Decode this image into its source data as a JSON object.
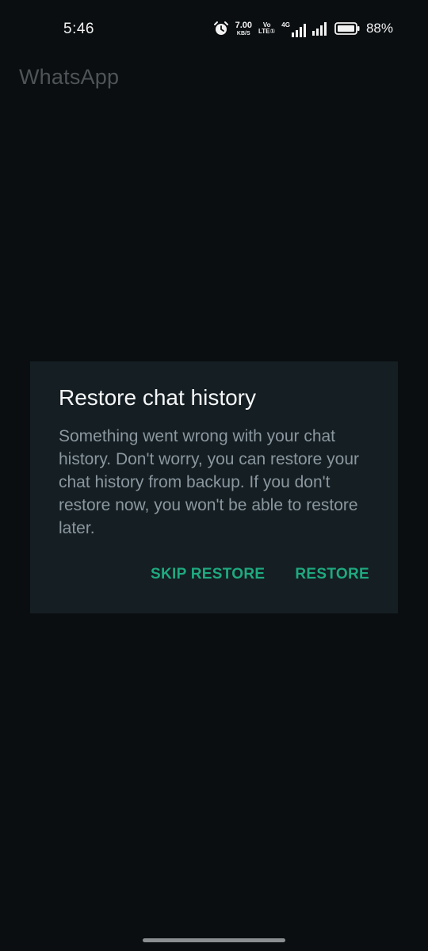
{
  "status_bar": {
    "time": "5:46",
    "net_speed_value": "7.00",
    "net_speed_unit": "KB/S",
    "volte_top": "Vo",
    "volte_bottom": "LTE①",
    "network_type": "4G",
    "battery_percent": "88%"
  },
  "app": {
    "title": "WhatsApp"
  },
  "dialog": {
    "title": "Restore chat history",
    "message": "Something went wrong with your chat history. Don't worry, you can restore your chat history from backup. If you don't restore now, you won't be able to restore later.",
    "buttons": {
      "skip": "SKIP RESTORE",
      "restore": "RESTORE"
    }
  },
  "colors": {
    "background": "#0a0e11",
    "dialog_background": "#151e23",
    "accent": "#1fa97f",
    "message_text": "#8a979e"
  },
  "icons": {
    "alarm": "alarm-icon",
    "signal": "signal-icon",
    "battery": "battery-icon"
  }
}
